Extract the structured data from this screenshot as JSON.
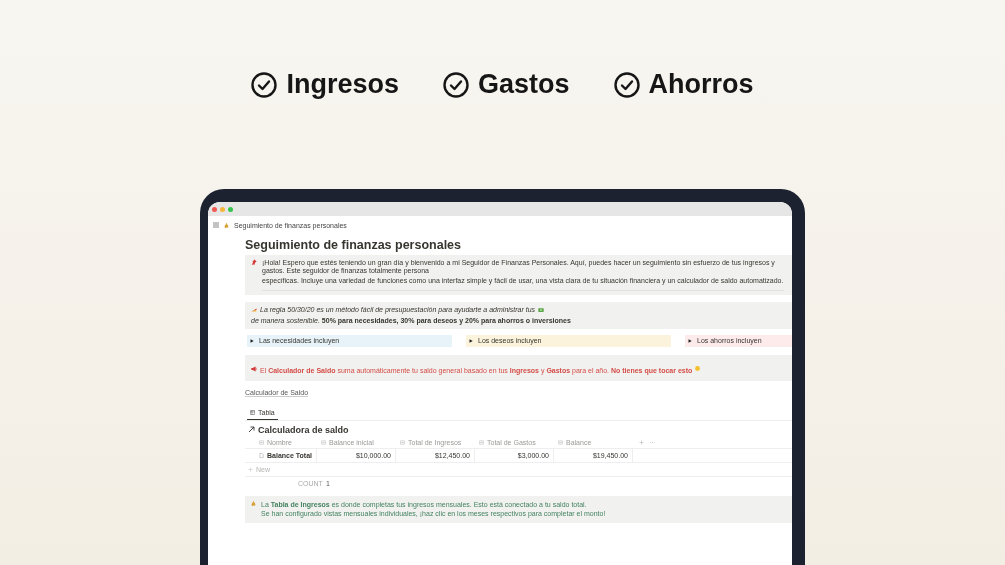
{
  "headline": [
    {
      "label": "Ingresos"
    },
    {
      "label": "Gastos"
    },
    {
      "label": "Ahorros"
    }
  ],
  "window": {
    "breadcrumb": "Seguimiento de finanzas personales"
  },
  "page": {
    "title": "Seguimiento de finanzas personales",
    "intro_lines": [
      "¡Hola! Espero que estés teniendo un gran día y bienvenido a mi Seguidor de Finanzas Personales. Aquí, puedes hacer un seguimiento sin esfuerzo de tus ingresos y gastos. Este seguidor de finanzas totalmente persona",
      "específicas. Incluye una variedad de funciones como una interfaz simple y fácil de usar, una vista clara de tu situación financiera y un calculador de saldo automatizado."
    ],
    "rule_a": "*La regla 50/30/20 es un método fácil de presupuestación para ayudarte a administrar tus*",
    "rule_b": "*de manera sostenible.* **50% para necesidades, 30% para deseos y 20% para ahorros o inversiones**",
    "toggles": [
      {
        "label": "Las necesidades incluyen",
        "color": "#e7f3f8"
      },
      {
        "label": "Los deseos incluyen",
        "color": "#fbf3db"
      },
      {
        "label": "Los ahorros incluyen",
        "color": "#fdebec"
      }
    ],
    "calc_note": "El **Calculador de Saldo** suma automáticamente tu saldo general basado en tus **Ingresos** y **Gastos** para el año. **No tienes que tocar esto**",
    "link": "Calculador de Saldo",
    "tabs": [
      {
        "label": "Tabla",
        "selected": true
      }
    ],
    "db_title": "Calculadora de saldo",
    "columns": [
      {
        "label": "Nombre"
      },
      {
        "label": "Balance inicial"
      },
      {
        "label": "Total de Ingresos"
      },
      {
        "label": "Total de Gastos"
      },
      {
        "label": "Balance"
      }
    ],
    "rows": [
      {
        "cells": [
          "Balance Total",
          "$10,000.00",
          "$12,450.00",
          "$3,000.00",
          "$19,450.00"
        ]
      }
    ],
    "new_label": "New",
    "count_label": "COUNT",
    "count": "1",
    "income_lines": [
      "La **Tabla de Ingresos** es donde completas tus ingresos mensuales. Esto está conectado a tu saldo total.",
      "Se han configurado vistas mensuales individuales, ¡haz clic en los meses respectivos para completar el monto!"
    ]
  }
}
